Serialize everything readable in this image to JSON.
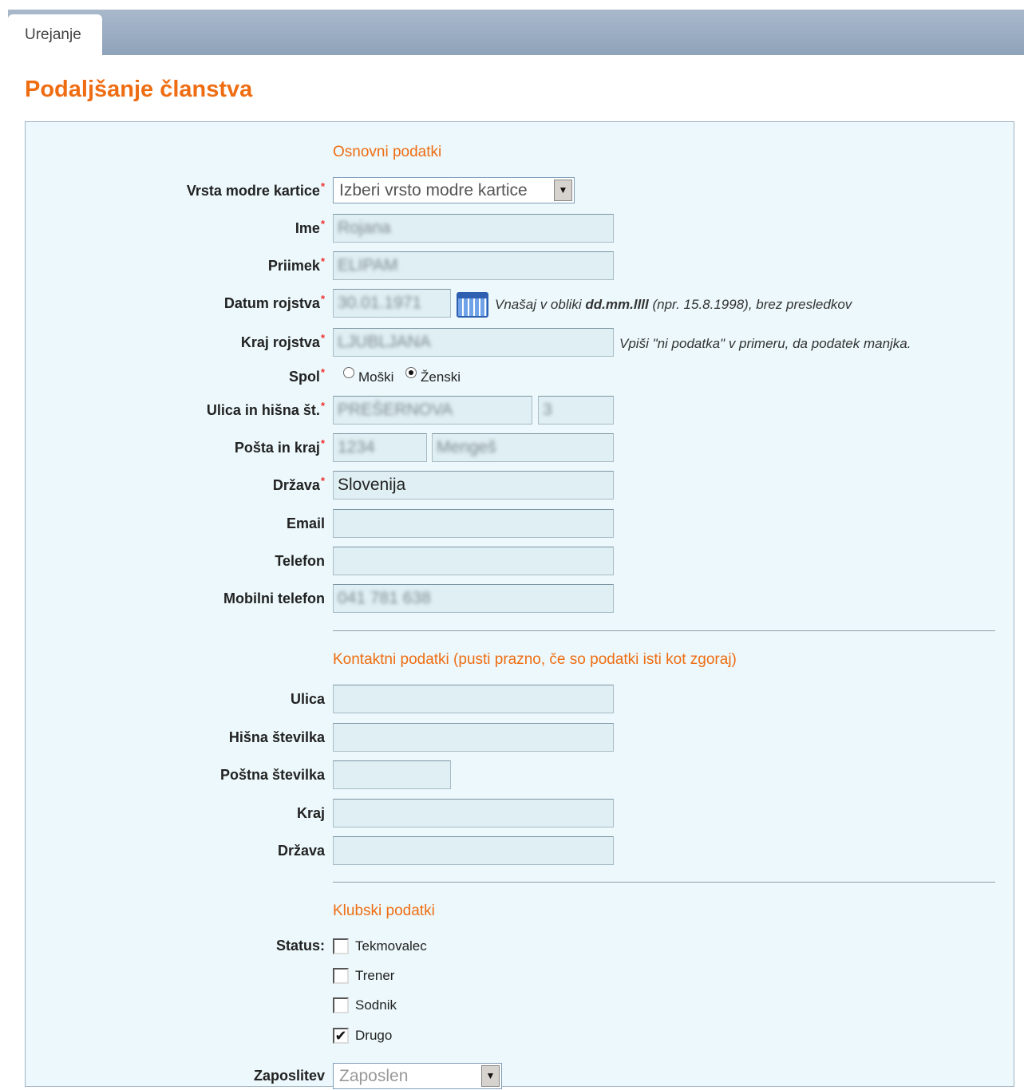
{
  "tabs": [
    {
      "label": "Urejanje"
    }
  ],
  "page_title": "Podaljšanje članstva",
  "sections": {
    "basic": "Osnovni podatki",
    "contact": "Kontaktni podatki (pusti prazno, če so podatki isti kot zgoraj)",
    "club": "Klubski podatki"
  },
  "basic": {
    "card_type": {
      "label": "Vrsta modre kartice",
      "value": "Izberi vrsto modre kartice"
    },
    "first_name": {
      "label": "Ime",
      "value": "Rojana"
    },
    "last_name": {
      "label": "Priimek",
      "value": "ELIPAM"
    },
    "birth_date": {
      "label": "Datum rojstva",
      "value": "30.01.1971",
      "hint_pre": "Vnašaj v obliki",
      "hint_format": "dd.mm.llll",
      "hint_post": "(npr. 15.8.1998), brez presledkov"
    },
    "birth_place": {
      "label": "Kraj rojstva",
      "value": "LJUBLJANA",
      "hint": "Vpiši \"ni podatka\" v primeru, da podatek manjka."
    },
    "gender": {
      "label": "Spol",
      "options": [
        "Moški",
        "Ženski"
      ],
      "selected": "Ženski"
    },
    "street": {
      "label": "Ulica in hišna št.",
      "street_value": "PREŠERNOVA",
      "number_value": "3"
    },
    "post": {
      "label": "Pošta in kraj",
      "code_value": "1234",
      "city_value": "Mengeš"
    },
    "country": {
      "label": "Država",
      "value": "Slovenija"
    },
    "email": {
      "label": "Email",
      "value": ""
    },
    "phone": {
      "label": "Telefon",
      "value": ""
    },
    "mobile": {
      "label": "Mobilni telefon",
      "value": "041 781 638"
    }
  },
  "contact": {
    "street": {
      "label": "Ulica",
      "value": ""
    },
    "house_number": {
      "label": "Hišna številka",
      "value": ""
    },
    "postal_code": {
      "label": "Poštna številka",
      "value": ""
    },
    "city": {
      "label": "Kraj",
      "value": ""
    },
    "country": {
      "label": "Država",
      "value": ""
    }
  },
  "club": {
    "status_label": "Status:",
    "statuses": [
      {
        "label": "Tekmovalec",
        "checked": false
      },
      {
        "label": "Trener",
        "checked": false
      },
      {
        "label": "Sodnik",
        "checked": false
      },
      {
        "label": "Drugo",
        "checked": true
      }
    ],
    "employment": {
      "label": "Zaposlitev",
      "value": "Zaposlen"
    }
  },
  "required_mark": "*",
  "check_mark": "✔",
  "colors": {
    "accent": "#ef6d12",
    "panel_bg": "#ecf8fb",
    "input_bg": "#dfeff3",
    "required": "#ef3030",
    "tabbar": "#94a7bd"
  }
}
